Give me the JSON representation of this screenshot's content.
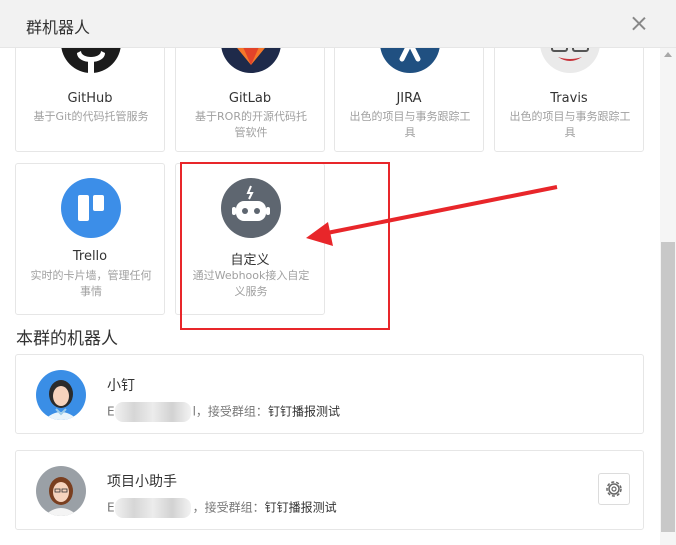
{
  "dialog": {
    "title": "群机器人"
  },
  "integrations": [
    {
      "name": "GitHub",
      "desc": "基于Git的代码托管服务",
      "icon": "github-icon"
    },
    {
      "name": "GitLab",
      "desc": "基于ROR的开源代码托管软件",
      "icon": "gitlab-icon"
    },
    {
      "name": "JIRA",
      "desc": "出色的项目与事务跟踪工具",
      "icon": "jira-icon"
    },
    {
      "name": "Travis",
      "desc": "出色的项目与事务跟踪工具",
      "icon": "travis-icon"
    },
    {
      "name": "Trello",
      "desc": "实时的卡片墙，管理任何事情",
      "icon": "trello-icon"
    },
    {
      "name": "自定义",
      "desc": "通过Webhook接入自定义服务",
      "icon": "robot-icon"
    }
  ],
  "section": {
    "title": "本群的机器人"
  },
  "robots": [
    {
      "name": "小钉",
      "prefix": "E",
      "mid": "l，接受群组：",
      "group": "钉钉播报测试"
    },
    {
      "name": "项目小助手",
      "prefix": "E",
      "mid": "，接受群组：",
      "group": "钉钉播报测试"
    }
  ],
  "colors": {
    "highlight": "#e8262a",
    "header_bg": "#f2f2f2"
  }
}
